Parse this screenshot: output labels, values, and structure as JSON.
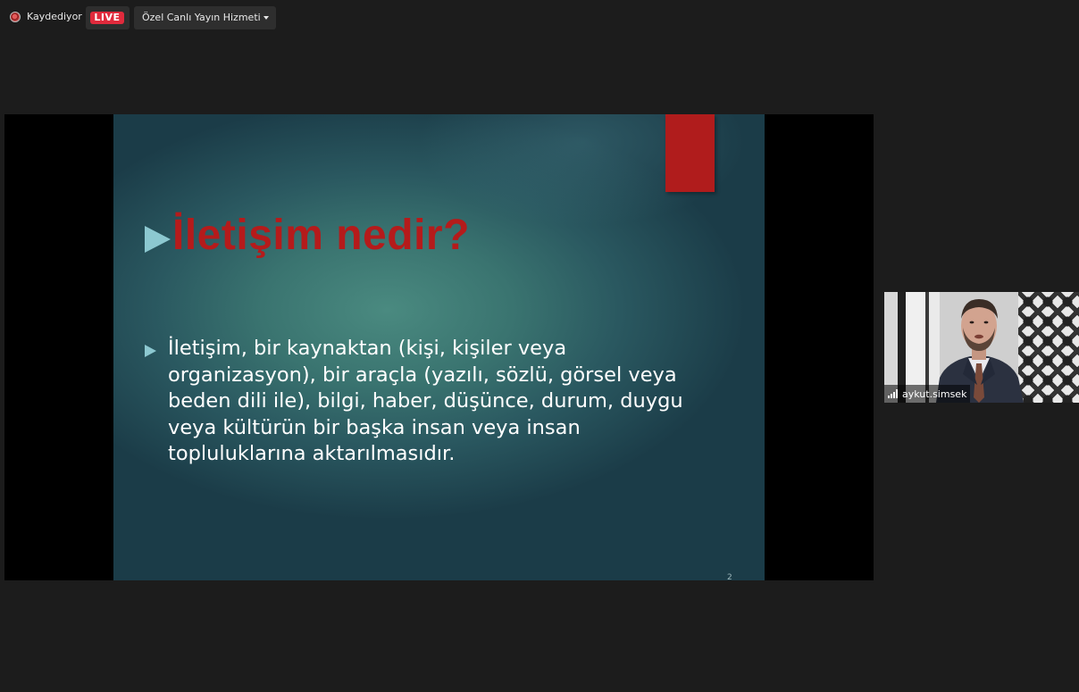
{
  "topbar": {
    "recording_label": "Kaydediyor",
    "live_label": "LIVE",
    "stream_service": "Özel Canlı Yayın Hizmeti"
  },
  "slide": {
    "title": "İletişim nedir?",
    "body": "İletişim, bir kaynaktan (kişi, kişiler veya organizasyon), bir araçla (yazılı, sözlü, görsel veya beden dili ile), bilgi, haber, düşünce, durum, duygu veya kültürün bir başka insan veya insan topluluklarına aktarılmasıdır.",
    "page_number": "2"
  },
  "participant": {
    "name": "aykut.simsek"
  },
  "colors": {
    "background": "#1c1c1c",
    "live_badge": "#e02a3c",
    "slide_title": "#b51b1b",
    "slide_accent": "#8cc8d0",
    "red_tab": "#b01c1c"
  },
  "icons": {
    "recording": "record-icon",
    "dropdown": "chevron-down-icon",
    "signal": "signal-strength-icon"
  }
}
